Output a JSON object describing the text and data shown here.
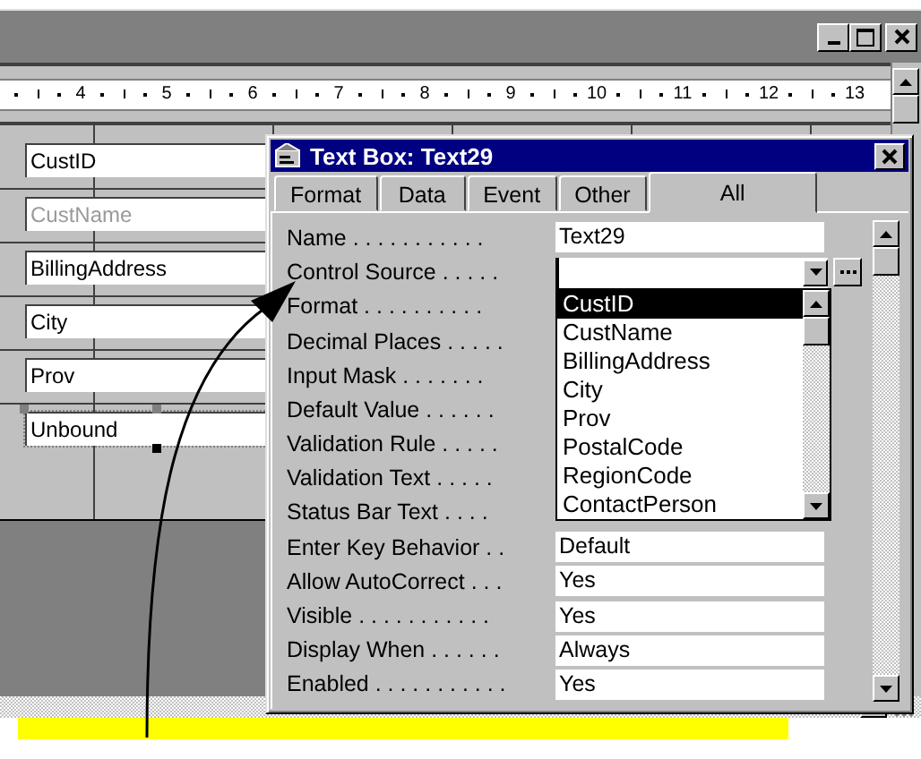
{
  "ruler": {
    "marks": [
      "4",
      "5",
      "6",
      "7",
      "8",
      "9",
      "10",
      "11",
      "12",
      "13"
    ]
  },
  "form_fields": [
    {
      "text": "CustID",
      "disabled": false,
      "selected": false
    },
    {
      "text": "CustName",
      "disabled": true,
      "selected": false
    },
    {
      "text": "BillingAddress",
      "disabled": false,
      "selected": false
    },
    {
      "text": "City",
      "disabled": false,
      "selected": false
    },
    {
      "text": "Prov",
      "disabled": false,
      "selected": false
    },
    {
      "text": "Unbound",
      "disabled": false,
      "selected": true
    }
  ],
  "property_sheet": {
    "title": "Text Box: Text29",
    "tabs": [
      {
        "label": "Format",
        "selected": false
      },
      {
        "label": "Data",
        "selected": false
      },
      {
        "label": "Event",
        "selected": false
      },
      {
        "label": "Other",
        "selected": false
      },
      {
        "label": "All",
        "selected": true
      }
    ],
    "properties": [
      {
        "name": "Name . . . . . . . . . . .",
        "kind": "text",
        "value": "Text29"
      },
      {
        "name": "Control Source . . . . .",
        "kind": "combo"
      },
      {
        "name": "Format . . . . . . . . . .",
        "kind": "hidden"
      },
      {
        "name": "Decimal Places . . . . .",
        "kind": "hidden"
      },
      {
        "name": "Input Mask . . . . . . .",
        "kind": "hidden"
      },
      {
        "name": "Default Value . . . . . .",
        "kind": "hidden"
      },
      {
        "name": "Validation Rule . . . . .",
        "kind": "hidden"
      },
      {
        "name": "Validation Text . . . . .",
        "kind": "hidden"
      },
      {
        "name": "Status Bar Text . . . .",
        "kind": "hidden"
      },
      {
        "name": "Enter Key Behavior . .",
        "kind": "text",
        "value": "Default"
      },
      {
        "name": "Allow AutoCorrect . . .",
        "kind": "text",
        "value": "Yes"
      },
      {
        "name": "Visible . . . . . . . . . . .",
        "kind": "text",
        "value": "Yes"
      },
      {
        "name": "Display When . . . . . .",
        "kind": "text",
        "value": "Always"
      },
      {
        "name": "Enabled . . . . . . . . . . .",
        "kind": "text",
        "value": "Yes"
      }
    ],
    "dropdown": {
      "items": [
        {
          "label": "CustID",
          "selected": true
        },
        {
          "label": "CustName",
          "selected": false
        },
        {
          "label": "BillingAddress",
          "selected": false
        },
        {
          "label": "City",
          "selected": false
        },
        {
          "label": "Prov",
          "selected": false
        },
        {
          "label": "PostalCode",
          "selected": false
        },
        {
          "label": "RegionCode",
          "selected": false
        },
        {
          "label": "ContactPerson",
          "selected": false
        }
      ]
    }
  }
}
